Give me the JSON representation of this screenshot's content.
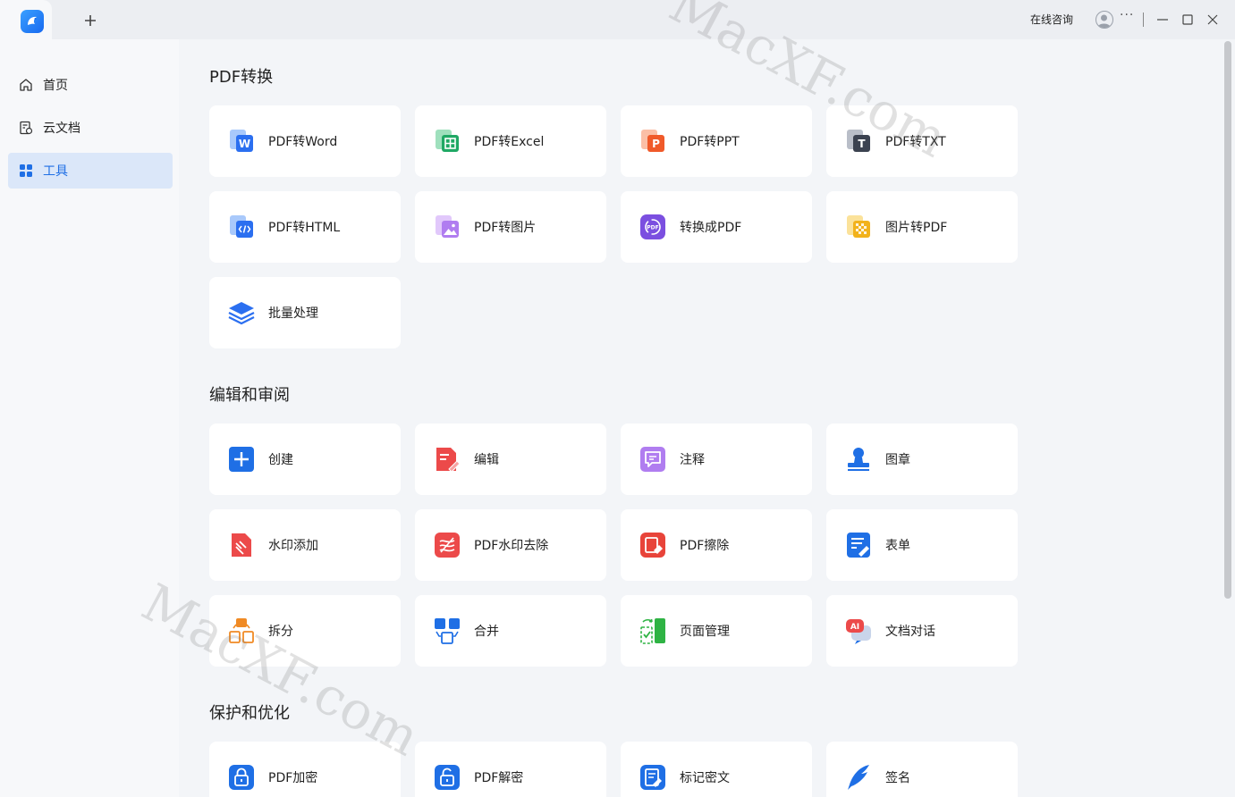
{
  "titlebar": {
    "consult_label": "在线咨询",
    "more_label": "···"
  },
  "sidebar": {
    "items": [
      {
        "label": "首页",
        "icon": "home-icon"
      },
      {
        "label": "云文档",
        "icon": "cloud-doc-icon"
      },
      {
        "label": "工具",
        "icon": "tools-grid-icon",
        "active": true
      }
    ]
  },
  "sections": [
    {
      "title": "PDF转换",
      "tools": [
        {
          "label": "PDF转Word",
          "icon": "word-icon",
          "color": "#2b6ff0"
        },
        {
          "label": "PDF转Excel",
          "icon": "excel-icon",
          "color": "#1fa864"
        },
        {
          "label": "PDF转PPT",
          "icon": "ppt-icon",
          "color": "#f05a2a"
        },
        {
          "label": "PDF转TXT",
          "icon": "txt-icon",
          "color": "#3b4250"
        },
        {
          "label": "PDF转HTML",
          "icon": "html-icon",
          "color": "#2b6ff0"
        },
        {
          "label": "PDF转图片",
          "icon": "image-icon",
          "color": "#9b5fe0"
        },
        {
          "label": "转换成PDF",
          "icon": "convert-pdf-icon",
          "color": "#7b4fe0"
        },
        {
          "label": "图片转PDF",
          "icon": "image-to-pdf-icon",
          "color": "#f2b21b"
        },
        {
          "label": "批量处理",
          "icon": "batch-layers-icon",
          "color": "#2b6ff0"
        }
      ]
    },
    {
      "title": "编辑和审阅",
      "tools": [
        {
          "label": "创建",
          "icon": "create-plus-icon",
          "color": "#1f6fe5"
        },
        {
          "label": "编辑",
          "icon": "edit-icon",
          "color": "#ec4a4a"
        },
        {
          "label": "注释",
          "icon": "comment-icon",
          "color": "#9b5fe0"
        },
        {
          "label": "图章",
          "icon": "stamp-icon",
          "color": "#1f6fe5"
        },
        {
          "label": "水印添加",
          "icon": "watermark-add-icon",
          "color": "#ec4a4a"
        },
        {
          "label": "PDF水印去除",
          "icon": "watermark-remove-icon",
          "color": "#ec4a4a"
        },
        {
          "label": "PDF擦除",
          "icon": "erase-icon",
          "color": "#e8443a"
        },
        {
          "label": "表单",
          "icon": "form-icon",
          "color": "#1f6fe5"
        },
        {
          "label": "拆分",
          "icon": "split-icon",
          "color": "#f08a24"
        },
        {
          "label": "合并",
          "icon": "merge-icon",
          "color": "#1f6fe5"
        },
        {
          "label": "页面管理",
          "icon": "page-manage-icon",
          "color": "#2fb344"
        },
        {
          "label": "文档对话",
          "icon": "ai-chat-icon",
          "color": "#ec4a4a"
        }
      ]
    },
    {
      "title": "保护和优化",
      "tools": [
        {
          "label": "PDF加密",
          "icon": "lock-icon",
          "color": "#1f6fe5"
        },
        {
          "label": "PDF解密",
          "icon": "unlock-icon",
          "color": "#1f6fe5"
        },
        {
          "label": "标记密文",
          "icon": "redact-icon",
          "color": "#1f6fe5"
        },
        {
          "label": "签名",
          "icon": "signature-pen-icon",
          "color": "#1f6fe5"
        }
      ]
    }
  ],
  "watermark": {
    "text1": "MacXF.com",
    "text2": "MacXF.com"
  }
}
